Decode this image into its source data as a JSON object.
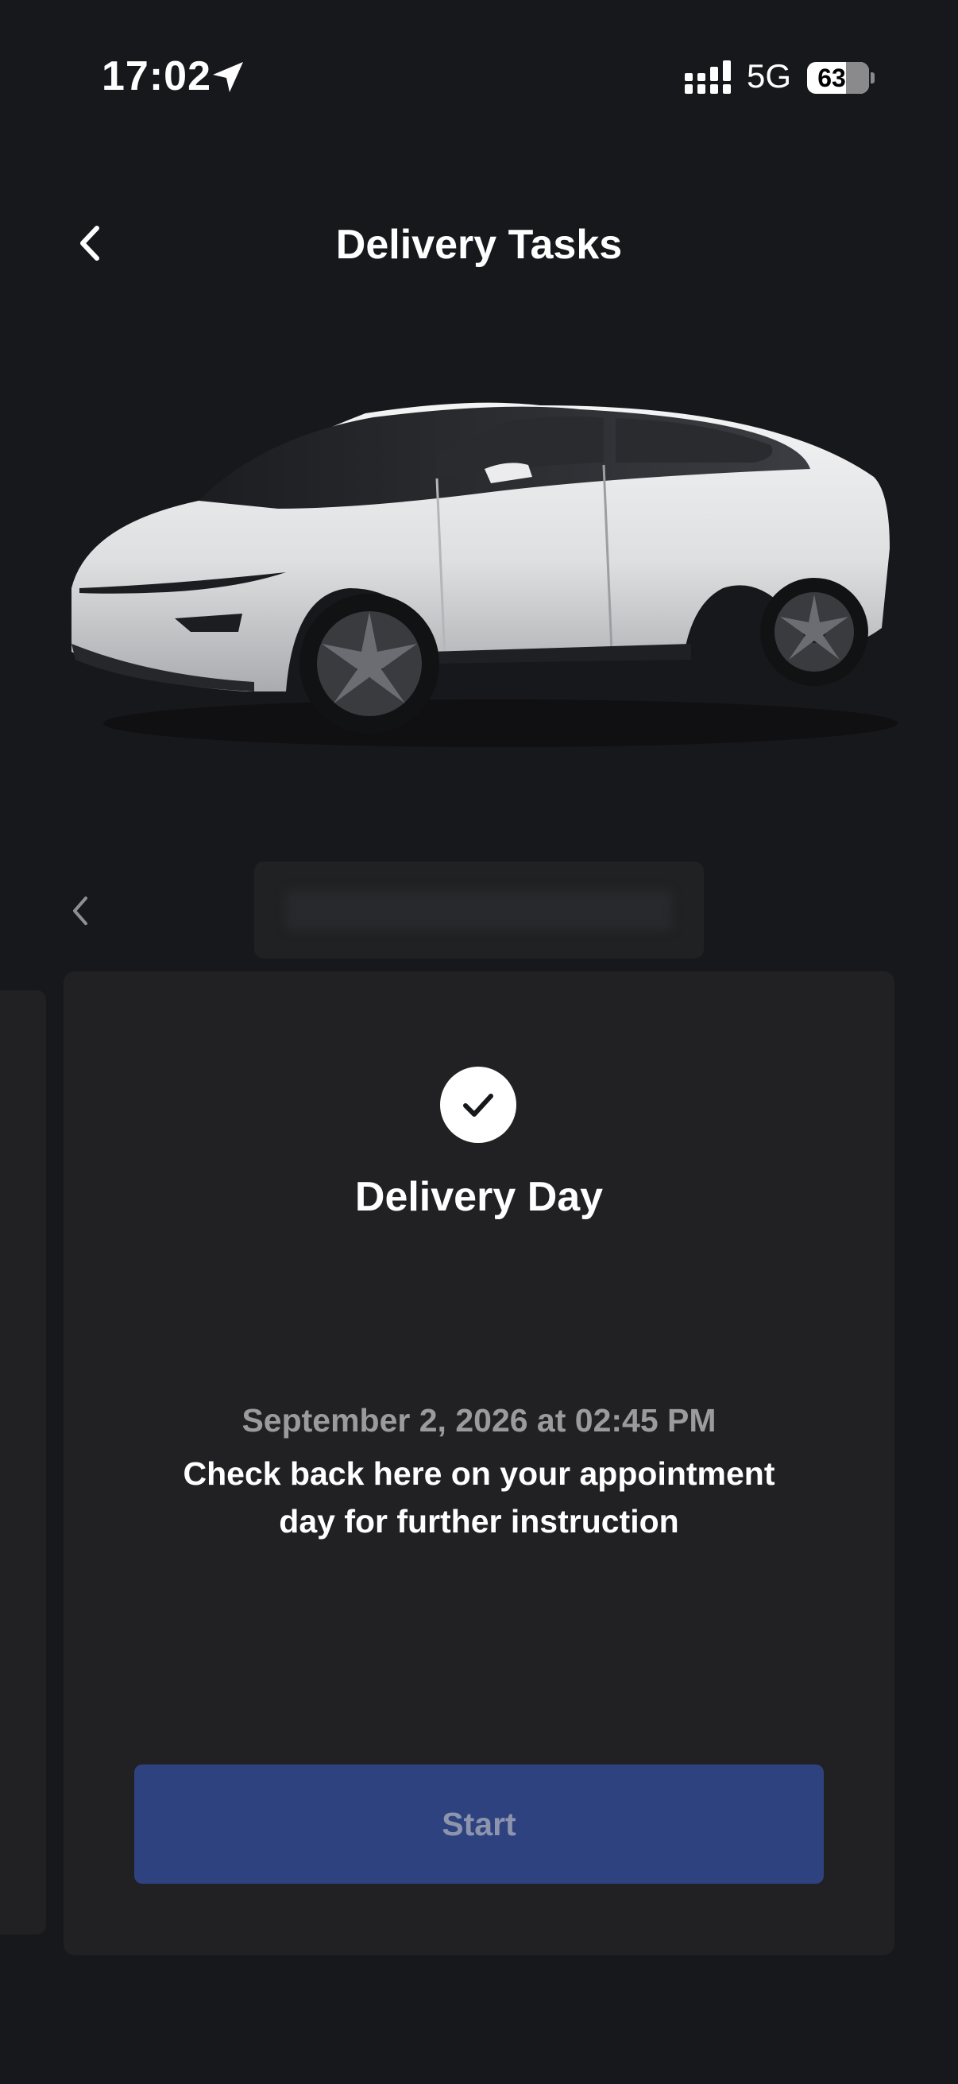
{
  "status_bar": {
    "time": "17:02",
    "network": "5G",
    "battery_percent": "63",
    "battery_level": 0.63,
    "icons": [
      "location-arrow-icon",
      "cellular-signal-icon",
      "battery-icon"
    ]
  },
  "header": {
    "title": "Delivery Tasks",
    "back_icon": "chevron-left-icon"
  },
  "vehicle": {
    "image": "white-suv-image",
    "selector_prev_icon": "chevron-left-icon"
  },
  "task_card": {
    "status_icon": "checkmark-icon",
    "title": "Delivery Day",
    "appointment": "September 2, 2026 at 02:45 PM",
    "instruction": "Check back here on your appointment day for further instruction",
    "button_label": "Start"
  },
  "colors": {
    "background": "#17181b",
    "card": "#212123",
    "button": "#2e4280",
    "button_text": "#8d95ad",
    "muted_text": "#9b9b9e"
  }
}
